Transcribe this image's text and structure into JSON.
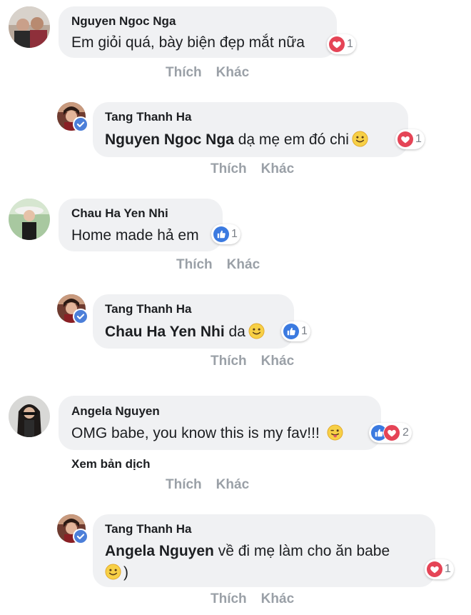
{
  "comments": [
    {
      "author": "Nguyen Ngoc Nga",
      "text": "Em giỏi quá, bày biện đẹp mắt nữa",
      "reaction_count": "1"
    },
    {
      "author": "Tang Thanh Ha",
      "mention": "Nguyen Ngoc Nga",
      "text": " dạ mẹ em đó chi",
      "reaction_count": "1"
    },
    {
      "author": "Chau Ha Yen Nhi",
      "text": "Home made hả em",
      "reaction_count": "1"
    },
    {
      "author": "Tang Thanh Ha",
      "mention": "Chau Ha Yen Nhi",
      "text": " da",
      "reaction_count": "1"
    },
    {
      "author": "Angela Nguyen",
      "text": "OMG babe, you know this is my fav!!!",
      "reaction_count": "2",
      "translate": "Xem bản dịch"
    },
    {
      "author": "Tang Thanh Ha",
      "mention": "Angela Nguyen",
      "text": " về đi mẹ làm cho ăn babe",
      "text_line2": ")",
      "reaction_count": "1"
    }
  ],
  "actions": {
    "like": "Thích",
    "more": "Khác"
  },
  "colors": {
    "bubble": "#f0f1f3",
    "heart": "#e54456",
    "like": "#3b7ae0",
    "action_text": "#9aa0a7"
  },
  "icons": {
    "heart": "heart-icon",
    "like": "thumbs-up-icon",
    "verified": "verified-check-icon",
    "smile": "smile-emoji-icon",
    "tongue": "tongue-emoji-icon"
  }
}
